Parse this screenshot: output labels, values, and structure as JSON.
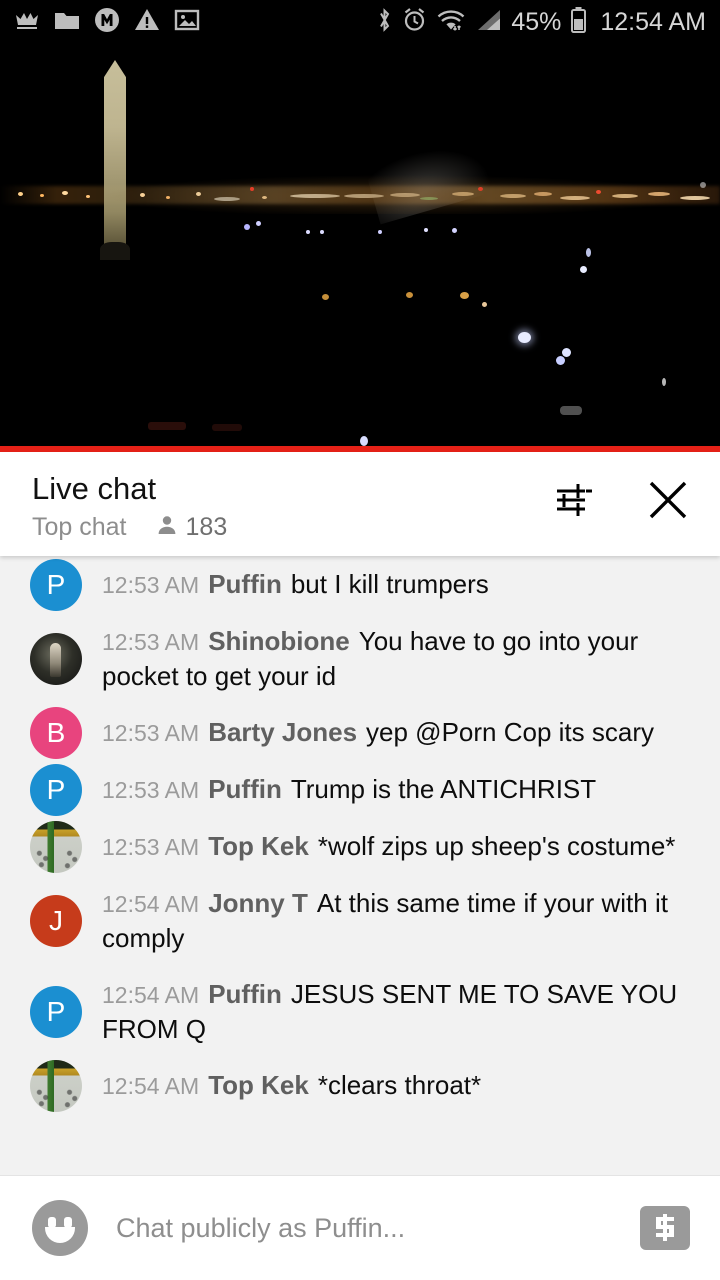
{
  "status_bar": {
    "left_icons": [
      "crown-icon",
      "folder-icon",
      "m-circle-icon",
      "warning-triangle-icon",
      "image-icon"
    ],
    "right_icons": [
      "bluetooth-icon",
      "alarm-icon",
      "wifi-icon",
      "cellular-signal-icon",
      "battery-icon"
    ],
    "battery_percent": "45%",
    "clock": "12:54 AM"
  },
  "video": {
    "title": "live-stream-washington-dc-night",
    "progress_percent": 100,
    "progress_color": "#e62117"
  },
  "chat_header": {
    "title": "Live chat",
    "mode": "Top chat",
    "viewer_count": "183",
    "viewers_icon": "person-icon",
    "settings_icon": "tune-sliders-icon",
    "close_icon": "close-x-icon"
  },
  "messages": [
    {
      "time": "12:53 AM",
      "author": "Puffin",
      "text": "but I kill trumpers",
      "avatar_type": "letter",
      "avatar_letter": "P",
      "avatar_color": "#1b8fd1"
    },
    {
      "time": "12:53 AM",
      "author": "Shinobione",
      "text": "You have to go into your pocket to get your id",
      "avatar_type": "photo-dark",
      "avatar_letter": "",
      "avatar_color": "#2e2f28"
    },
    {
      "time": "12:53 AM",
      "author": "Barty Jones",
      "text": "yep @Porn Cop its scary",
      "avatar_type": "letter",
      "avatar_letter": "B",
      "avatar_color": "#e8447e"
    },
    {
      "time": "12:53 AM",
      "author": "Puffin",
      "text": "Trump is the ANTICHRIST",
      "avatar_type": "letter",
      "avatar_letter": "P",
      "avatar_color": "#1b8fd1"
    },
    {
      "time": "12:53 AM",
      "author": "Top Kek",
      "text": "*wolf zips up sheep's costume*",
      "avatar_type": "photo-crusader",
      "avatar_letter": "",
      "avatar_color": "#c4c8c0"
    },
    {
      "time": "12:54 AM",
      "author": "Jonny T",
      "text": "At this same time if your with it comply",
      "avatar_type": "letter",
      "avatar_letter": "J",
      "avatar_color": "#c63b1b"
    },
    {
      "time": "12:54 AM",
      "author": "Puffin",
      "text": "JESUS SENT ME TO SAVE YOU FROM Q",
      "avatar_type": "letter",
      "avatar_letter": "P",
      "avatar_color": "#1b8fd1"
    },
    {
      "time": "12:54 AM",
      "author": "Top Kek",
      "text": "*clears throat*",
      "avatar_type": "photo-crusader",
      "avatar_letter": "",
      "avatar_color": "#c4c8c0"
    }
  ],
  "input_bar": {
    "emoji_icon": "emoji-smiley-icon",
    "placeholder": "Chat publicly as Puffin...",
    "value": "",
    "superchat_icon": "dollar-superchat-icon"
  }
}
